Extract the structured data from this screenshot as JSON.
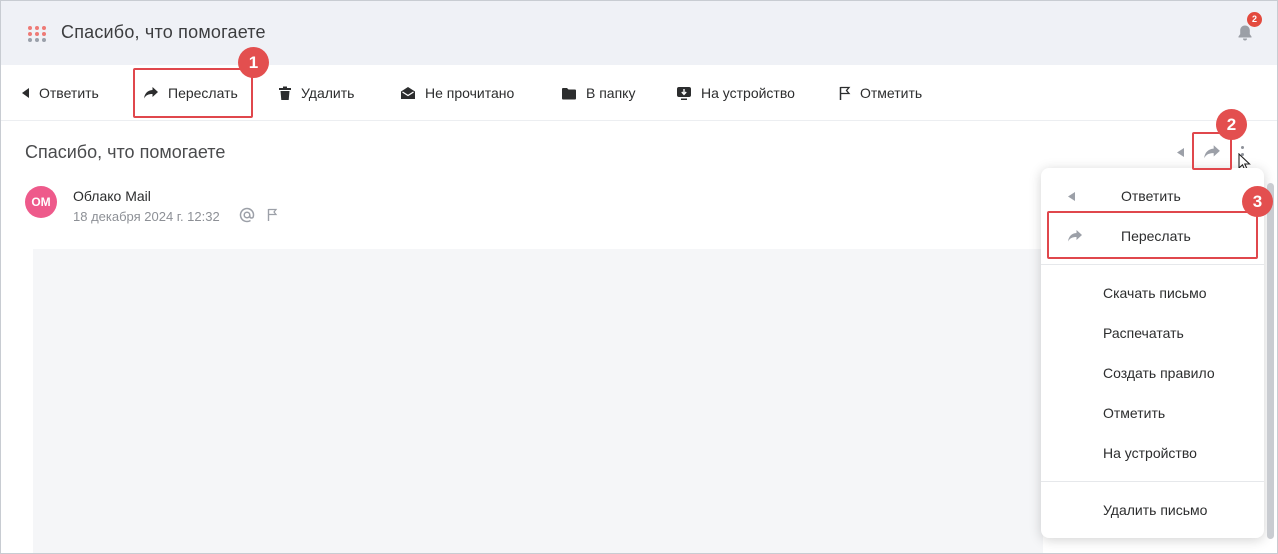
{
  "header": {
    "title": "Спасибо, что помогаете",
    "notification_count": "2"
  },
  "toolbar": {
    "reply": "Ответить",
    "forward": "Переслать",
    "delete": "Удалить",
    "unread": "Не прочитано",
    "to_folder": "В папку",
    "to_device": "На устройство",
    "mark": "Отметить"
  },
  "message": {
    "subject": "Спасибо, что помогаете",
    "avatar_initials": "ОМ",
    "sender": "Облако Mail",
    "date": "18 декабря 2024 г. 12:32"
  },
  "menu": {
    "items": [
      {
        "label": "Ответить",
        "icon": "reply-icon"
      },
      {
        "label": "Переслать",
        "icon": "forward-icon"
      },
      {
        "label": "Скачать письмо"
      },
      {
        "label": "Распечатать"
      },
      {
        "label": "Создать правило"
      },
      {
        "label": "Отметить"
      },
      {
        "label": "На устройство"
      },
      {
        "label": "Удалить письмо"
      }
    ]
  },
  "annotations": {
    "step1": "1",
    "step2": "2",
    "step3": "3"
  },
  "colors": {
    "highlight": "#e0474c",
    "header_bg": "#eff1f6",
    "avatar": "#ee5a8b"
  }
}
